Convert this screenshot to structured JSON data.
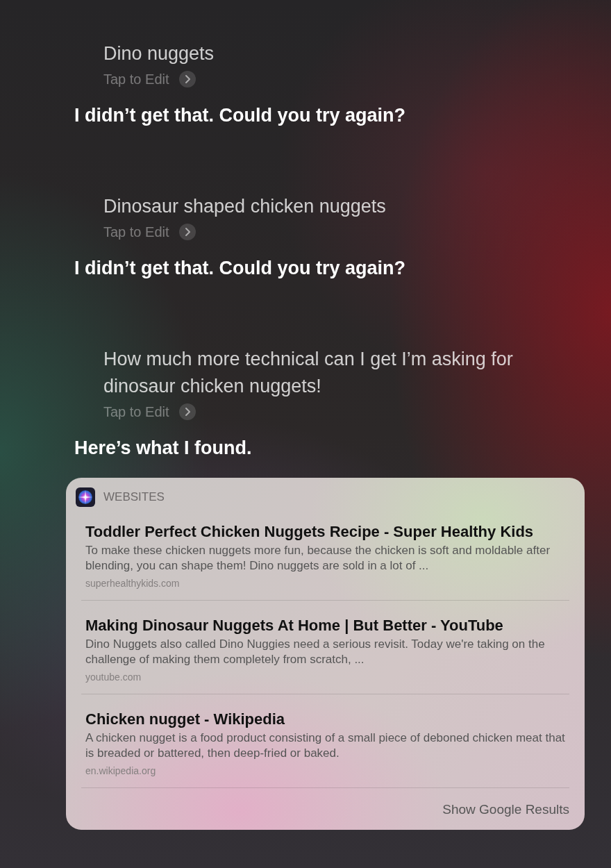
{
  "conversation": [
    {
      "query": "Dino nuggets",
      "edit_label": "Tap to Edit",
      "reply": "I didn’t get that. Could you try again?"
    },
    {
      "query": "Dinosaur shaped chicken nuggets",
      "edit_label": "Tap to Edit",
      "reply": "I didn’t get that. Could you try again?"
    },
    {
      "query": "How much more technical can I get I’m asking for dinosaur chicken nuggets!",
      "edit_label": "Tap to Edit",
      "reply": "Here’s what I found."
    }
  ],
  "results_card": {
    "section_label": "WEBSITES",
    "results": [
      {
        "title": "Toddler Perfect Chicken Nuggets Recipe - Super Healthy Kids",
        "snippet": "To make these chicken nuggets more fun, because the chicken is soft and moldable after blending, you can shape them! Dino nuggets are sold in a lot of ...",
        "domain": "superhealthykids.com"
      },
      {
        "title": "Making Dinosaur Nuggets At Home | But Better - YouTube",
        "snippet": "Dino Nuggets also called Dino Nuggies need a serious revisit. Today we're taking on the challenge of making them completely from scratch, ...",
        "domain": "youtube.com"
      },
      {
        "title": "Chicken nugget - Wikipedia",
        "snippet": "A chicken nugget is a food product consisting of a small piece of deboned chicken meat that is breaded or battered, then deep-fried or baked.",
        "domain": "en.wikipedia.org"
      }
    ],
    "footer_link": "Show Google Results"
  }
}
